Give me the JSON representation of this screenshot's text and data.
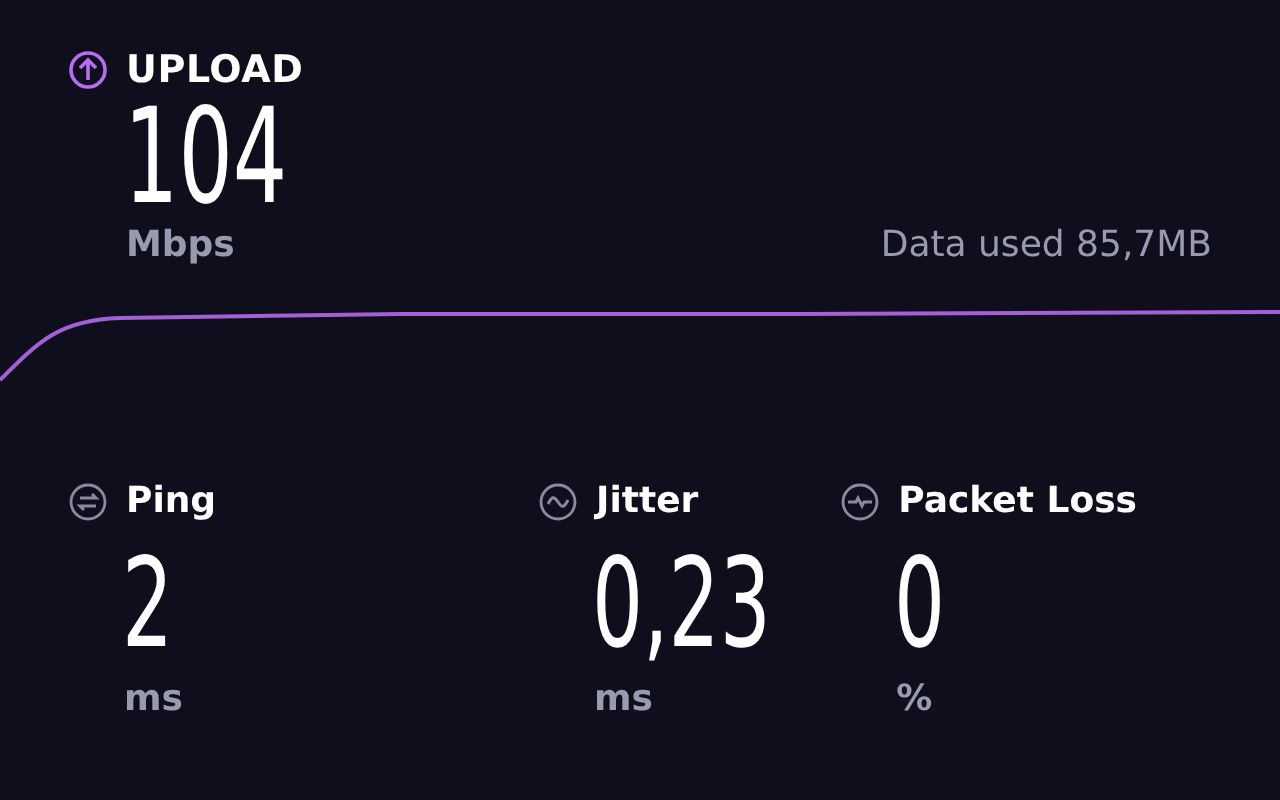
{
  "upload": {
    "label": "UPLOAD",
    "value": "104",
    "unit": "Mbps",
    "data_used": "Data used 85,7MB"
  },
  "metrics": [
    {
      "kind": "ping",
      "label": "Ping",
      "value": "2",
      "unit": "ms"
    },
    {
      "kind": "jitter",
      "label": "Jitter",
      "value": "0,23",
      "unit": "ms"
    },
    {
      "kind": "packet_loss",
      "label": "Packet Loss",
      "value": "0",
      "unit": "%"
    }
  ]
}
